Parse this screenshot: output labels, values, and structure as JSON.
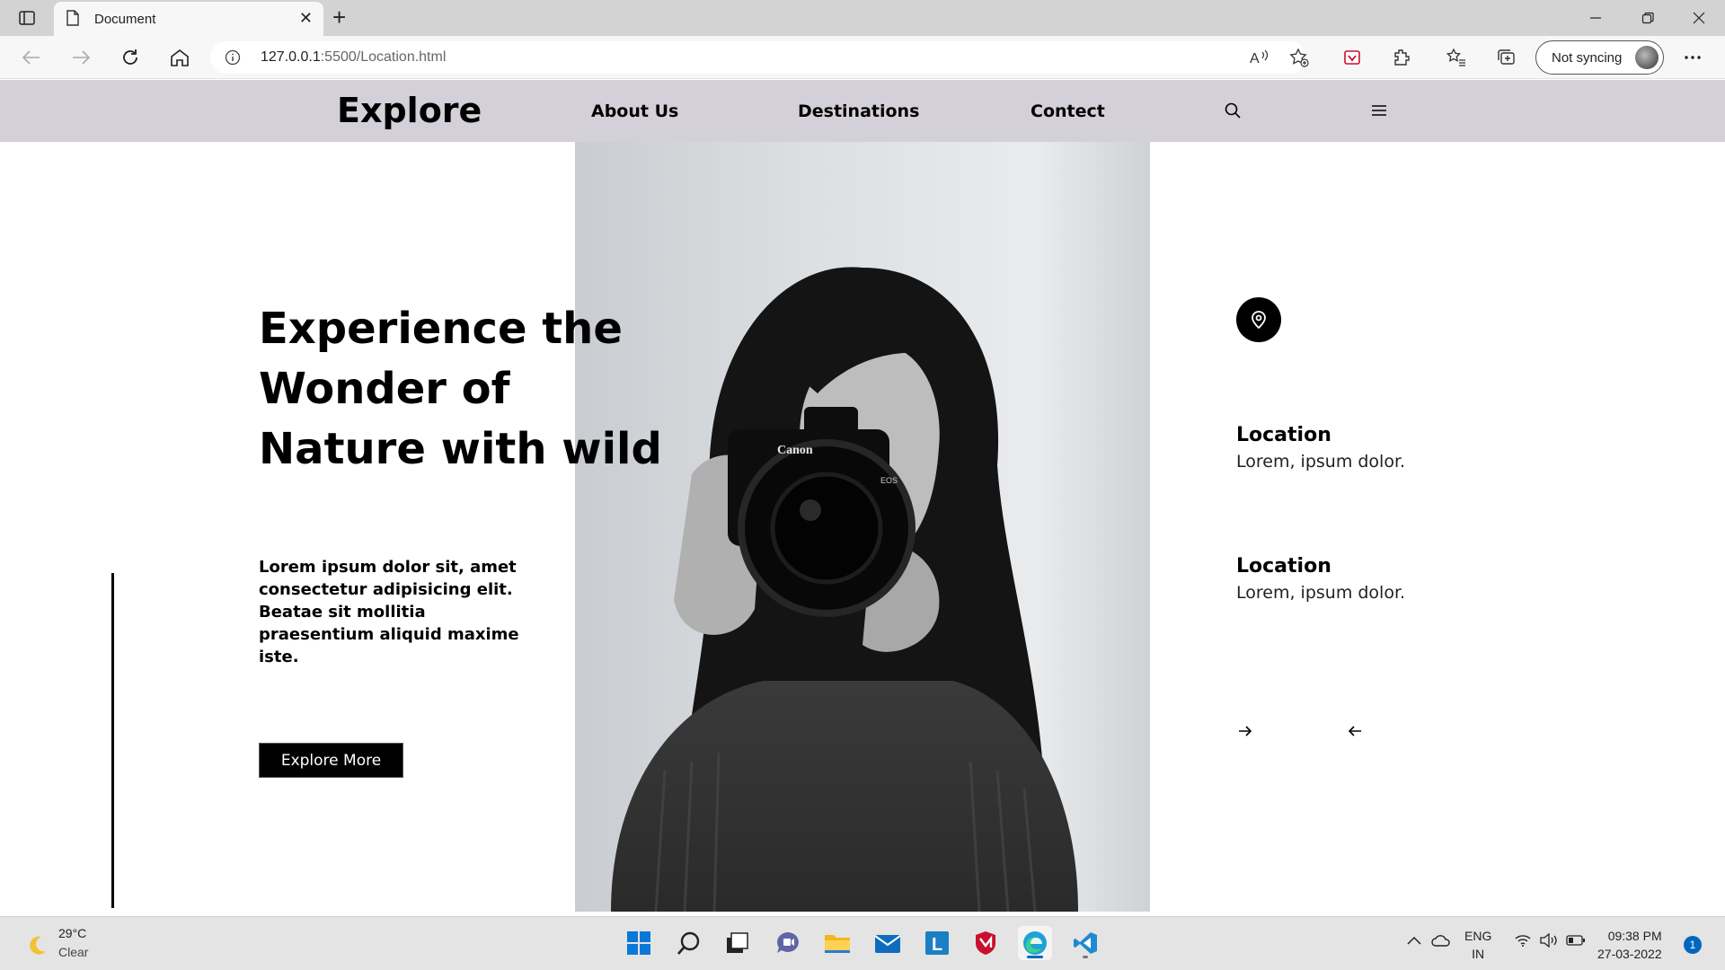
{
  "browser": {
    "tab_title": "Document",
    "url_host": "127.0.0.1",
    "url_rest": ":5500/Location.html",
    "sync_label": "Not syncing"
  },
  "site": {
    "brand": "Explore",
    "nav": [
      "About Us",
      "Destinations",
      "Contect"
    ],
    "hero_heading": [
      "Experience the",
      "Wonder of",
      "Nature with wild"
    ],
    "hero_description": "Lorem ipsum dolor sit, amet consectetur adipisicing elit. Beatae sit mollitia praesentium aliquid maxime iste.",
    "cta_label": "Explore More",
    "locations": [
      {
        "title": "Location",
        "subtitle": "Lorem, ipsum dolor."
      },
      {
        "title": "Location",
        "subtitle": "Lorem, ipsum dolor."
      }
    ],
    "photo_camera_brand": "Canon",
    "photo_camera_model": "EOS"
  },
  "taskbar": {
    "temperature": "29°C",
    "condition": "Clear",
    "lang_line1": "ENG",
    "lang_line2": "IN",
    "time": "09:38 PM",
    "date": "27-03-2022",
    "notification_count": "1"
  },
  "colors": {
    "nav_bg": "#d4d0d9",
    "accent": "#000000",
    "taskbar_bg": "#e4e4e4"
  }
}
